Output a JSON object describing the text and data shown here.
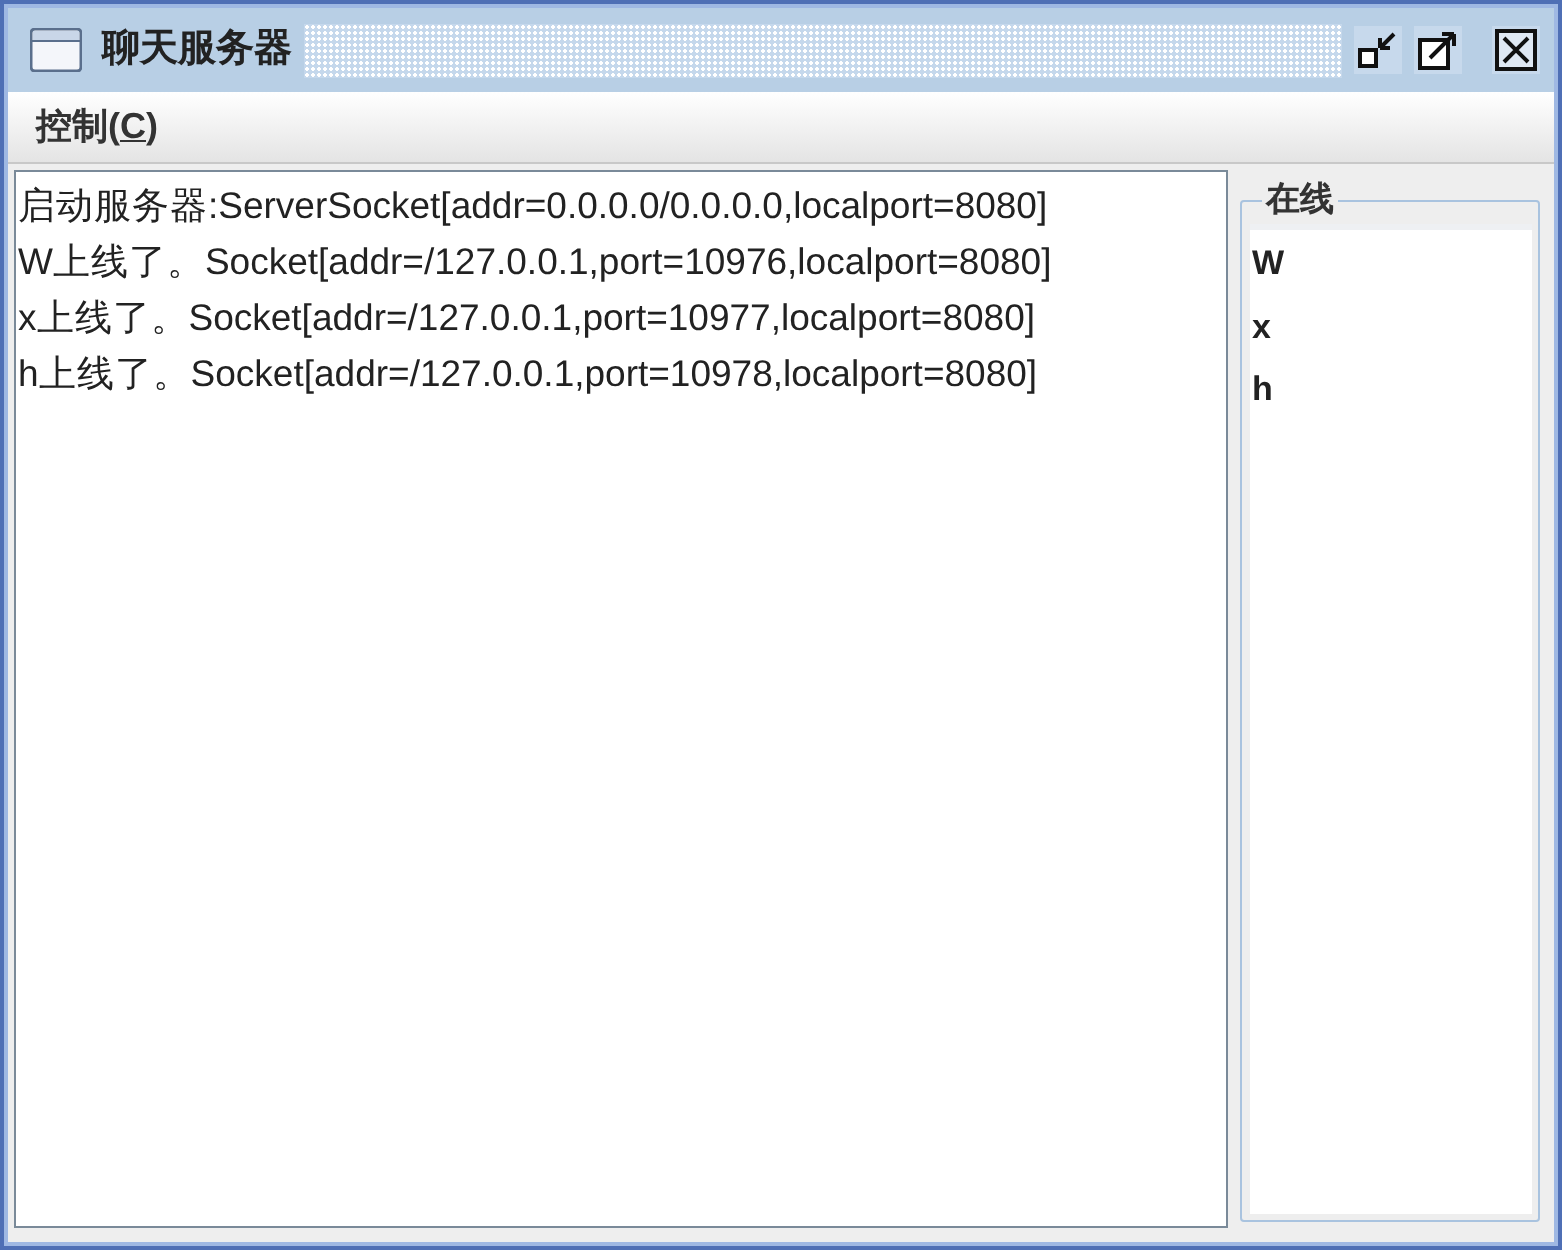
{
  "window": {
    "title": "聊天服务器"
  },
  "menu": [
    {
      "text_before": "控制(",
      "mnemonic": "C",
      "text_after": ")"
    }
  ],
  "log": {
    "lines": [
      "启动服务器:ServerSocket[addr=0.0.0.0/0.0.0.0,localport=8080]",
      "W上线了。Socket[addr=/127.0.0.1,port=10976,localport=8080]",
      "x上线了。Socket[addr=/127.0.0.1,port=10977,localport=8080]",
      "h上线了。Socket[addr=/127.0.0.1,port=10978,localport=8080]"
    ]
  },
  "online_panel": {
    "title": "在线",
    "users": [
      "W",
      "x",
      "h"
    ]
  }
}
